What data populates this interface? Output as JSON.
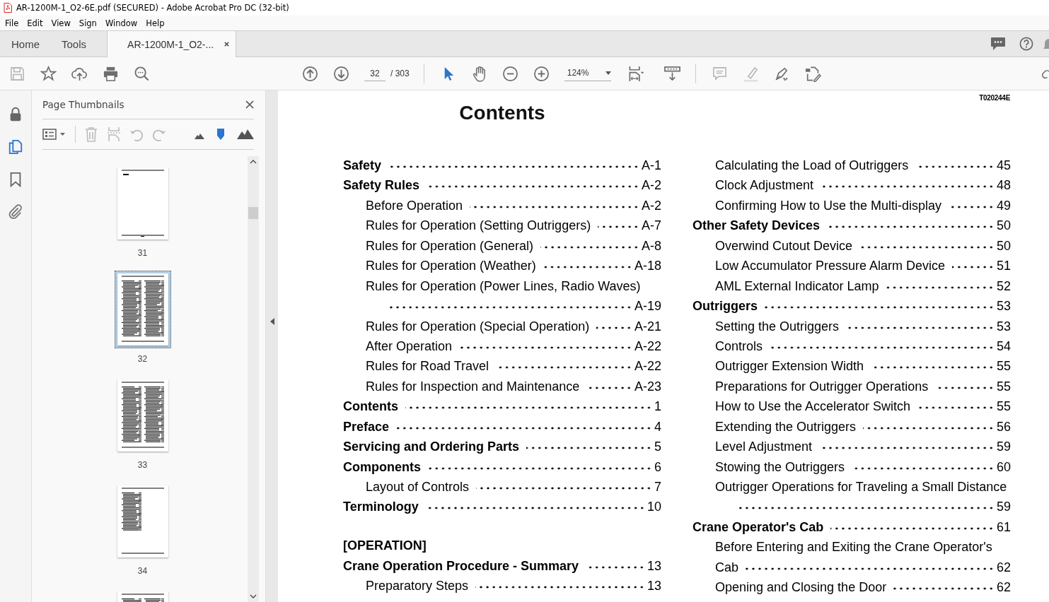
{
  "window": {
    "title": "AR-1200M-1_O2-6E.pdf (SECURED) - Adobe Acrobat Pro DC (32-bit)"
  },
  "menu": [
    "File",
    "Edit",
    "View",
    "Sign",
    "Window",
    "Help"
  ],
  "tabs": [
    {
      "label": "Home",
      "selected": false,
      "kind": "nav"
    },
    {
      "label": "Tools",
      "selected": false,
      "kind": "nav"
    },
    {
      "label": "AR-1200M-1_O2-...",
      "selected": true,
      "kind": "document"
    }
  ],
  "toolbar": {
    "page_number": "32",
    "page_total": "/ 303",
    "zoom": "124%"
  },
  "side_rail": [
    {
      "kind": "lock",
      "selected": false
    },
    {
      "kind": "pages",
      "selected": true
    },
    {
      "kind": "bookmark",
      "selected": false
    },
    {
      "kind": "attachment",
      "selected": false
    }
  ],
  "thumbnail_panel": {
    "title": "Page Thumbnails",
    "thumbnails": [
      {
        "label": "31",
        "selected": false
      },
      {
        "label": "32",
        "selected": true
      },
      {
        "label": "33",
        "selected": false
      },
      {
        "label": "34",
        "selected": false
      },
      {
        "selected": false
      }
    ]
  },
  "document": {
    "code": "T020244E",
    "title": "Contents",
    "columns": [
      [
        {
          "title": "Safety",
          "page": "A-1"
        },
        {
          "title": "Safety Rules",
          "page": "A-2",
          "children": [
            {
              "title": "Before Operation",
              "page": "A-2"
            },
            {
              "title": "Rules for Operation (Setting Outriggers)",
              "page": "A-7"
            },
            {
              "title": "Rules for Operation (General)",
              "page": "A-8"
            },
            {
              "title": "Rules for Operation (Weather)",
              "page": "A-18"
            },
            {
              "title": "Rules for Operation (Power Lines, Radio Waves)",
              "page": "A-19",
              "leader_wrap": true
            },
            {
              "title": "Rules for Operation (Special Operation)",
              "page": "A-21"
            },
            {
              "title": "After Operation",
              "page": "A-22"
            },
            {
              "title": "Rules for Road Travel",
              "page": "A-22"
            },
            {
              "title": "Rules for Inspection and Maintenance",
              "page": "A-23"
            }
          ]
        },
        {
          "title": "Contents",
          "page": "1"
        },
        {
          "title": "Preface",
          "page": "4"
        },
        {
          "title": "Servicing and Ordering Parts",
          "page": "5"
        },
        {
          "title": "Components",
          "page": "6",
          "children": [
            {
              "title": "Layout of Controls",
              "page": "7"
            }
          ]
        },
        {
          "title": "Terminology",
          "page": "10"
        },
        {
          "kind": "part",
          "title": "[OPERATION]"
        },
        {
          "title": "Crane Operation Procedure - Summary",
          "page": "13",
          "children": [
            {
              "title": "Preparatory Steps",
              "page": "13"
            }
          ]
        }
      ],
      [
        {
          "kind": "continued",
          "children": [
            {
              "title": "Calculating the Load of Outriggers",
              "page": "45"
            },
            {
              "title": "Clock Adjustment",
              "page": "48"
            },
            {
              "title": "Confirming How to Use the Multi-display",
              "page": "49"
            }
          ]
        },
        {
          "title": "Other Safety Devices",
          "page": "50",
          "children": [
            {
              "title": "Overwind Cutout Device",
              "page": "50"
            },
            {
              "title": "Low Accumulator Pressure Alarm Device",
              "page": "51"
            },
            {
              "title": "AML External Indicator Lamp",
              "page": "52"
            }
          ]
        },
        {
          "title": "Outriggers",
          "page": "53",
          "children": [
            {
              "title": "Setting the Outriggers",
              "page": "53"
            },
            {
              "title": "Controls",
              "page": "54"
            },
            {
              "title": "Outrigger Extension Width",
              "page": "55"
            },
            {
              "title": "Preparations for Outrigger Operations",
              "page": "55"
            },
            {
              "title": "How to Use the Accelerator Switch",
              "page": "55"
            },
            {
              "title": "Extending the Outriggers",
              "page": "56"
            },
            {
              "title": "Level Adjustment",
              "page": "59"
            },
            {
              "title": "Stowing the Outriggers",
              "page": "60"
            },
            {
              "title": "Outrigger Operations for Traveling a Small Distance",
              "page": "59",
              "leader_wrap": true
            }
          ]
        },
        {
          "title": "Crane Operator's Cab",
          "page": "61",
          "children": [
            {
              "title": "Before Entering and Exiting the Crane Operator's",
              "continuation": "Cab",
              "page": "62"
            },
            {
              "title": "Opening and Closing the Door",
              "page": "62"
            }
          ]
        }
      ]
    ]
  }
}
